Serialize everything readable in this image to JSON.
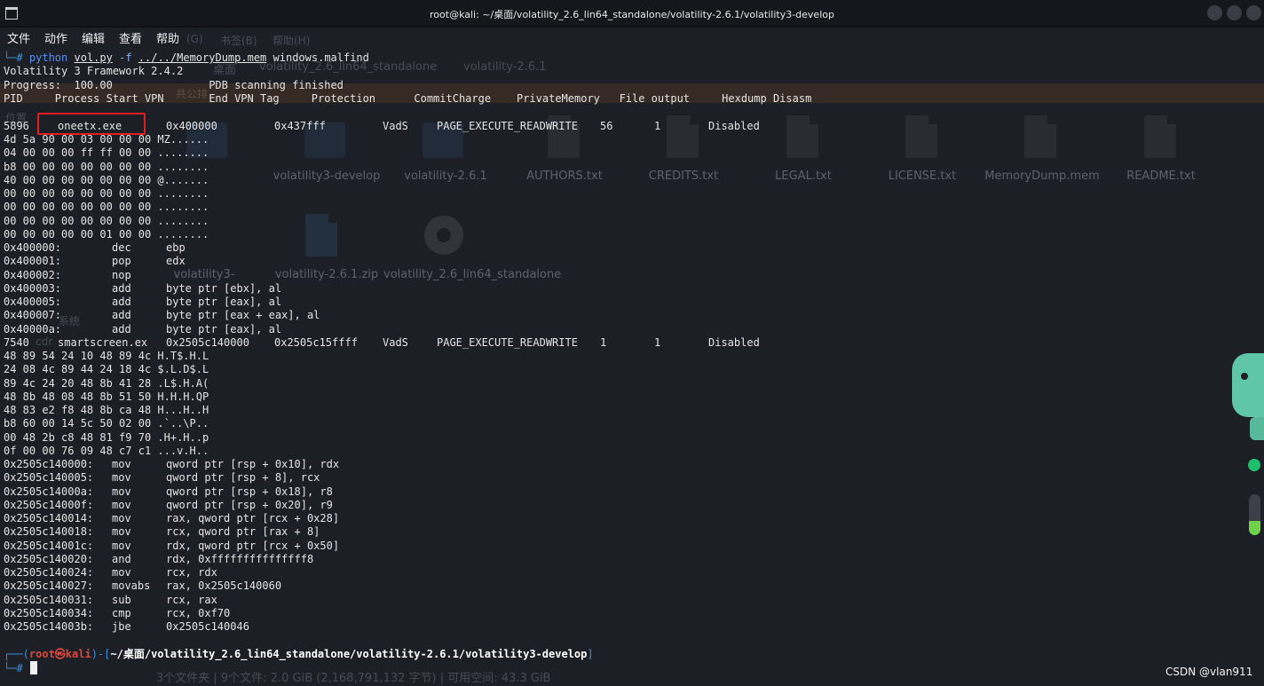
{
  "window": {
    "title": "root@kali: ~/桌面/volatility_2.6_lin64_standalone/volatility-2.6.1/volatility3-develop"
  },
  "menu": [
    "文件",
    "动作",
    "编辑",
    "查看",
    "帮助"
  ],
  "ghost": {
    "menu_extra": [
      "(G)",
      "书签(B)",
      "帮助(H)"
    ],
    "breadcrumb": [
      "桌面",
      "volatility_2.6_lin64_standalone",
      "volatility-2.6.1"
    ],
    "sidebar": [
      "位置",
      "系统",
      "cdr"
    ],
    "sidebar_extra": "共公排",
    "files_row1": [
      "volatility3-develop",
      "volatility-2.6.1",
      "AUTHORS.txt",
      "CREDITS.txt",
      "LEGAL.txt",
      "LICENSE.txt",
      "MemoryDump.mem",
      "README.txt"
    ],
    "files_row2": [
      "volatility3-",
      "volatility-2.6.1.zip",
      "volatility_2.6_lin64_standalone"
    ],
    "status": "3个文件夹 | 9个文件: 2.0 GiB (2,168,791,132 字节) | 可用空间: 43.3 GiB"
  },
  "terminal": {
    "command": {
      "prompt": "└─# ",
      "python": "python",
      "script": "vol.py",
      "flag": "-f",
      "file": "../../MemoryDump.mem",
      "plugin": "windows.malfind"
    },
    "framework": "Volatility 3 Framework 2.4.2",
    "progress": "Progress:  100.00               PDB scanning finished",
    "header": "PID     Process Start VPN       End VPN Tag     Protection      CommitCharge    PrivateMemory   File output     Hexdump Disasm",
    "entry1": {
      "pid": "5896",
      "process": "oneetx.exe",
      "start": "0x400000",
      "end": "0x437fff",
      "tag": "VadS",
      "protection": "PAGE_EXECUTE_READWRITE",
      "commit": "56",
      "private": "1",
      "file_output": "Disabled"
    },
    "hex1": [
      "4d 5a 90 00 03 00 00 00 MZ......",
      "04 00 00 00 ff ff 00 00 ........",
      "b8 00 00 00 00 00 00 00 ........",
      "40 00 00 00 00 00 00 00 @.......",
      "00 00 00 00 00 00 00 00 ........",
      "00 00 00 00 00 00 00 00 ........",
      "00 00 00 00 00 00 00 00 ........",
      "00 00 00 00 00 01 00 00 ........"
    ],
    "asm1": [
      {
        "addr": "0x400000:",
        "op": "dec",
        "args": "ebp"
      },
      {
        "addr": "0x400001:",
        "op": "pop",
        "args": "edx"
      },
      {
        "addr": "0x400002:",
        "op": "nop",
        "args": ""
      },
      {
        "addr": "0x400003:",
        "op": "add",
        "args": "byte ptr [ebx], al"
      },
      {
        "addr": "0x400005:",
        "op": "add",
        "args": "byte ptr [eax], al"
      },
      {
        "addr": "0x400007:",
        "op": "add",
        "args": "byte ptr [eax + eax], al"
      },
      {
        "addr": "0x40000a:",
        "op": "add",
        "args": "byte ptr [eax], al"
      }
    ],
    "entry2": {
      "pid": "7540",
      "process": "smartscreen.ex",
      "start": "0x2505c140000",
      "end": "0x2505c15ffff",
      "tag": "VadS",
      "protection": "PAGE_EXECUTE_READWRITE",
      "commit": "1",
      "private": "1",
      "file_output": "Disabled"
    },
    "hex2": [
      "48 89 54 24 10 48 89 4c H.T$.H.L",
      "24 08 4c 89 44 24 18 4c $.L.D$.L",
      "89 4c 24 20 48 8b 41 28 .L$.H.A(",
      "48 8b 48 08 48 8b 51 50 H.H.H.QP",
      "48 83 e2 f8 48 8b ca 48 H...H..H",
      "b8 60 00 14 5c 50 02 00 .`..\\P..",
      "00 48 2b c8 48 81 f9 70 .H+.H..p",
      "0f 00 00 76 09 48 c7 c1 ...v.H.."
    ],
    "asm2": [
      {
        "addr": "0x2505c140000:",
        "op": "mov",
        "args": "qword ptr [rsp + 0x10], rdx"
      },
      {
        "addr": "0x2505c140005:",
        "op": "mov",
        "args": "qword ptr [rsp + 8], rcx"
      },
      {
        "addr": "0x2505c14000a:",
        "op": "mov",
        "args": "qword ptr [rsp + 0x18], r8"
      },
      {
        "addr": "0x2505c14000f:",
        "op": "mov",
        "args": "qword ptr [rsp + 0x20], r9"
      },
      {
        "addr": "0x2505c140014:",
        "op": "mov",
        "args": "rax, qword ptr [rcx + 0x28]"
      },
      {
        "addr": "0x2505c140018:",
        "op": "mov",
        "args": "rcx, qword ptr [rax + 8]"
      },
      {
        "addr": "0x2505c14001c:",
        "op": "mov",
        "args": "rdx, qword ptr [rcx + 0x50]"
      },
      {
        "addr": "0x2505c140020:",
        "op": "and",
        "args": "rdx, 0xfffffffffffffff8"
      },
      {
        "addr": "0x2505c140024:",
        "op": "mov",
        "args": "rcx, rdx"
      },
      {
        "addr": "0x2505c140027:",
        "op": "movabs",
        "args": "rax, 0x2505c140060"
      },
      {
        "addr": "0x2505c140031:",
        "op": "sub",
        "args": "rcx, rax"
      },
      {
        "addr": "0x2505c140034:",
        "op": "cmp",
        "args": "rcx, 0xf70"
      },
      {
        "addr": "0x2505c14003b:",
        "op": "jbe",
        "args": "0x2505c140046"
      }
    ],
    "final_prompt": {
      "open": "┌──(",
      "user": "root㉿kali",
      "mid": ")-[",
      "path": "~/桌面/volatility_2.6_lin64_standalone/volatility-2.6.1/volatility3-develop",
      "close": "]",
      "line2": "└─#"
    }
  },
  "widgets": {
    "slider_level": 0.35
  },
  "watermark": "CSDN @vlan911"
}
